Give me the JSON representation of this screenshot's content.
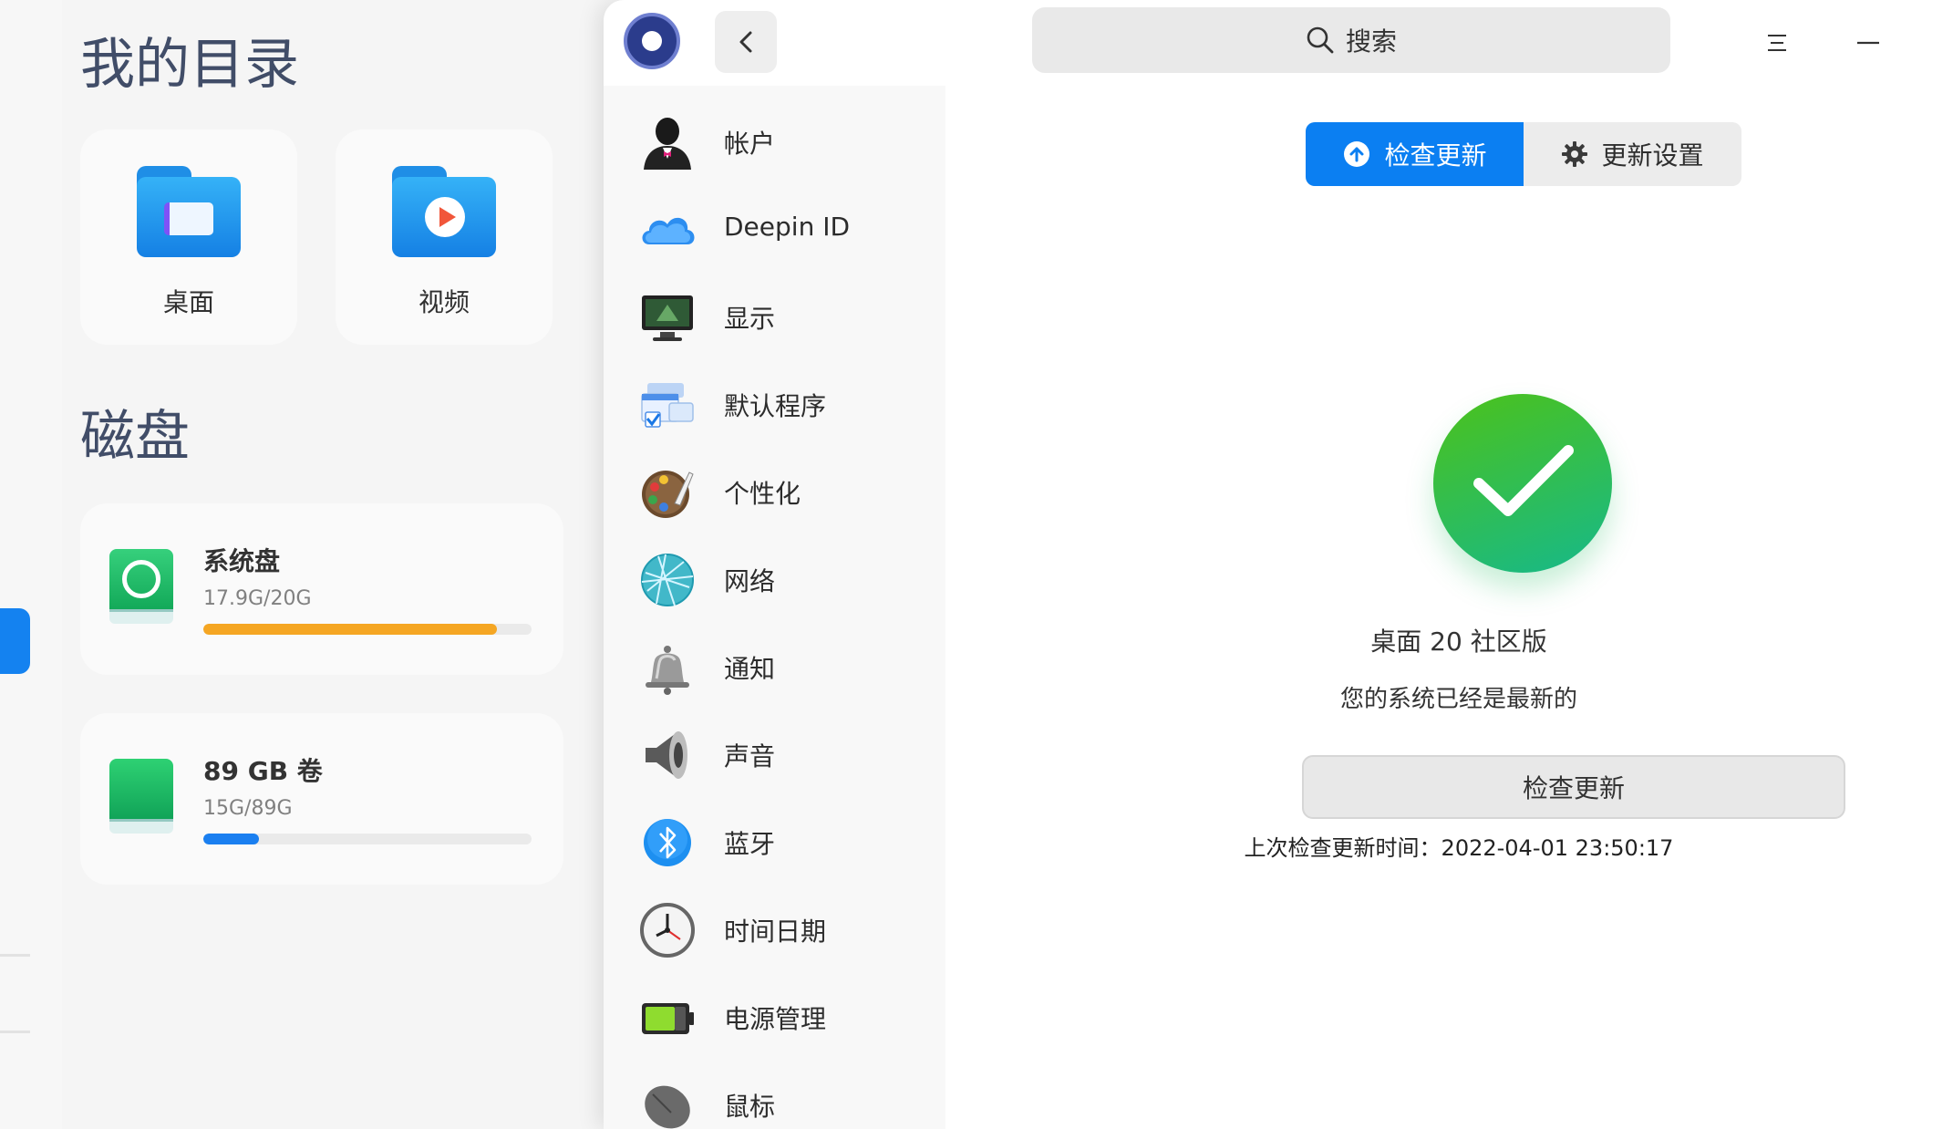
{
  "file_manager": {
    "heading_dirs": "我的目录",
    "folders": [
      {
        "label": "桌面",
        "icon": "desktop-folder-icon"
      },
      {
        "label": "视频",
        "icon": "video-folder-icon"
      }
    ],
    "heading_disks": "磁盘",
    "disks": [
      {
        "name": "系统盘",
        "size": "17.9G/20G",
        "used_fraction": 0.895,
        "bar_color": "#f5a623",
        "icon": "system-disk-icon"
      },
      {
        "name": "89 GB 卷",
        "size": "15G/89G",
        "used_fraction": 0.169,
        "bar_color": "#1a7ff0",
        "icon": "volume-disk-icon"
      }
    ]
  },
  "control_center": {
    "search": {
      "placeholder": "搜索"
    },
    "nav_items": [
      {
        "label": "帐户",
        "icon": "account-icon"
      },
      {
        "label": "Deepin ID",
        "icon": "cloud-icon"
      },
      {
        "label": "显示",
        "icon": "display-icon"
      },
      {
        "label": "默认程序",
        "icon": "default-apps-icon"
      },
      {
        "label": "个性化",
        "icon": "palette-icon"
      },
      {
        "label": "网络",
        "icon": "network-icon"
      },
      {
        "label": "通知",
        "icon": "bell-icon"
      },
      {
        "label": "声音",
        "icon": "speaker-icon"
      },
      {
        "label": "蓝牙",
        "icon": "bluetooth-icon"
      },
      {
        "label": "时间日期",
        "icon": "clock-icon"
      },
      {
        "label": "电源管理",
        "icon": "battery-icon"
      },
      {
        "label": "鼠标",
        "icon": "mouse-icon"
      }
    ],
    "tabs": {
      "check": "检查更新",
      "settings": "更新设置"
    },
    "update": {
      "edition": "桌面 20 社区版",
      "status": "您的系统已经是最新的",
      "check_button": "检查更新",
      "last_check": "上次检查更新时间：2022-04-01 23:50:17"
    }
  },
  "colors": {
    "accent": "#0b7ff2",
    "success": "#2cc05a"
  }
}
